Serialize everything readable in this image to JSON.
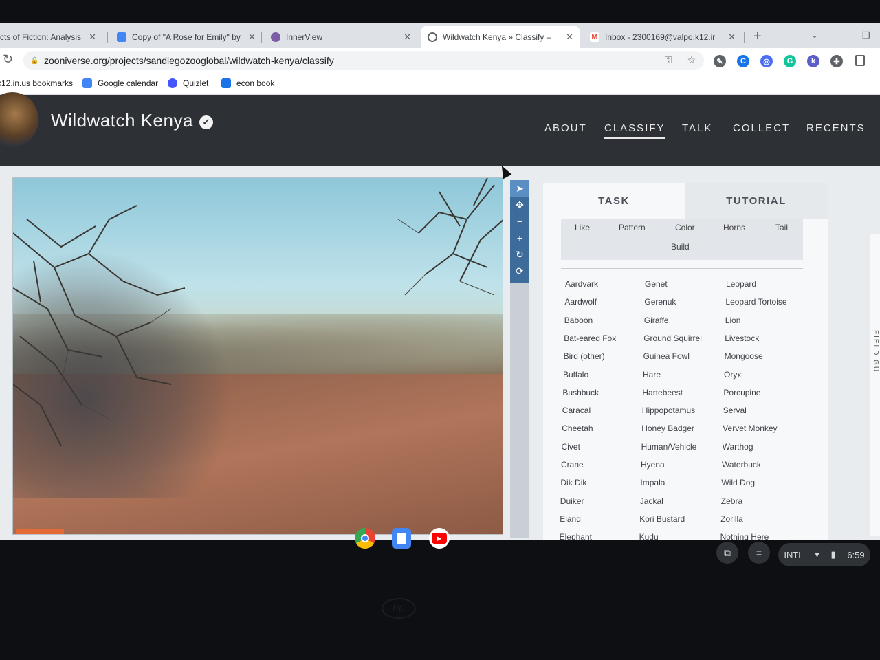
{
  "browser": {
    "tabs": [
      {
        "label": "cts of Fiction: Analysis P",
        "icon_color": "#8ab4f8",
        "active": false
      },
      {
        "label": "Copy of \"A Rose for Emily\" by",
        "icon_color": "#4285f4",
        "active": false
      },
      {
        "label": "InnerView",
        "icon_color": "#7b5ea7",
        "active": false
      },
      {
        "label": "Wildwatch Kenya » Classify –",
        "icon_color": "#5f6368",
        "active": true
      },
      {
        "label": "Inbox - 2300169@valpo.k12.ir",
        "icon_color": "#ea4335",
        "active": false
      }
    ],
    "url": "zooniverse.org/projects/sandiegozooglobal/wildwatch-kenya/classify",
    "bookmarks": [
      {
        "label": "k12.in.us bookmarks",
        "icon_color": ""
      },
      {
        "label": "Google calendar",
        "icon_color": "#4285f4"
      },
      {
        "label": "Quizlet",
        "icon_color": "#4255ff"
      },
      {
        "label": "econ book",
        "icon_color": "#1a73e8"
      }
    ],
    "extensions": [
      {
        "name": "pen-icon",
        "glyph": "✎",
        "color": "#5f6368"
      },
      {
        "name": "c-extension-icon",
        "glyph": "C",
        "color": "#1a73e8"
      },
      {
        "name": "circle-extension-icon",
        "glyph": "◎",
        "color": "#4c6ef5"
      },
      {
        "name": "grammarly-icon",
        "glyph": "G",
        "color": "#15c39a"
      },
      {
        "name": "k-extension-icon",
        "glyph": "k",
        "color": "#5b5fc7"
      },
      {
        "name": "puzzle-icon",
        "glyph": "✚",
        "color": "#5f6368"
      }
    ]
  },
  "site": {
    "title": "Wildwatch Kenya",
    "nav": [
      {
        "label": "ABOUT",
        "active": false
      },
      {
        "label": "CLASSIFY",
        "active": true
      },
      {
        "label": "TALK",
        "active": false
      },
      {
        "label": "COLLECT",
        "active": false
      },
      {
        "label": "RECENTS",
        "active": false
      }
    ]
  },
  "classifier": {
    "tabs": {
      "task": "TASK",
      "tutorial": "TUTORIAL"
    },
    "filters": [
      "Like",
      "Pattern",
      "Color",
      "Horns",
      "Tail",
      "Build"
    ],
    "choices_col1": [
      "Aardvark",
      "Aardwolf",
      "Baboon",
      "Bat-eared Fox",
      "Bird (other)",
      "Buffalo",
      "Bushbuck",
      "Caracal",
      "Cheetah",
      "Civet",
      "Crane",
      "Dik Dik",
      "Duiker",
      "Eland",
      "Elephant"
    ],
    "choices_col2": [
      "Genet",
      "Gerenuk",
      "Giraffe",
      "Ground Squirrel",
      "Guinea Fowl",
      "Hare",
      "Hartebeest",
      "Hippopotamus",
      "Honey Badger",
      "Human/Vehicle",
      "Hyena",
      "Impala",
      "Jackal",
      "Kori Bustard",
      "Kudu"
    ],
    "choices_col3": [
      "Leopard",
      "Leopard Tortoise",
      "Lion",
      "Livestock",
      "Mongoose",
      "Oryx",
      "Porcupine",
      "Serval",
      "Vervet Monkey",
      "Warthog",
      "Waterbuck",
      "Wild Dog",
      "Zebra",
      "Zorilla",
      "Nothing Here"
    ],
    "side_tab": "FIELD GU"
  },
  "system": {
    "input_method": "INTL",
    "time": "6:59"
  }
}
